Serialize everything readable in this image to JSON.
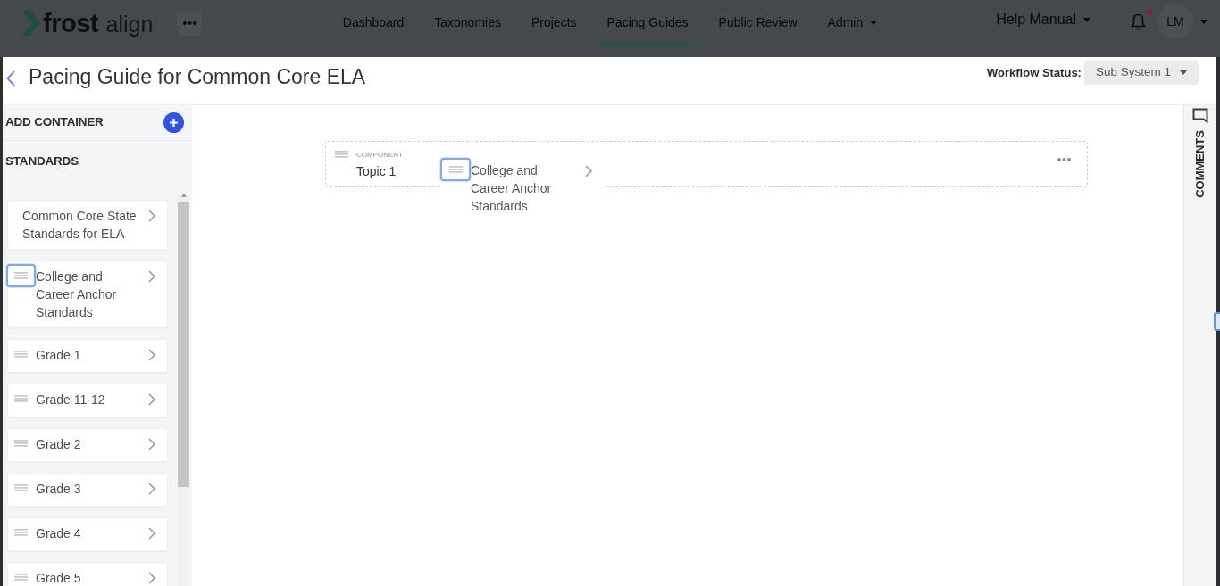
{
  "navbar": {
    "logo": {
      "brand": "frost",
      "product": "align"
    },
    "nav_items": [
      {
        "label": "Dashboard",
        "selected": false,
        "dropdown": false
      },
      {
        "label": "Taxonomies",
        "selected": false,
        "dropdown": false
      },
      {
        "label": "Projects",
        "selected": false,
        "dropdown": false
      },
      {
        "label": "Pacing Guides",
        "selected": true,
        "dropdown": false
      },
      {
        "label": "Public Review",
        "selected": false,
        "dropdown": false
      },
      {
        "label": "Admin",
        "selected": false,
        "dropdown": true
      }
    ],
    "help": {
      "label": "Help Manual",
      "dropdown": true
    },
    "notifications": {
      "unread": true
    },
    "user": {
      "initials": "LM"
    }
  },
  "header": {
    "title": "Pacing Guide for Common Core ELA",
    "workflow_label": "Workflow Status:",
    "workflow_value": "Sub System 1"
  },
  "sidebar": {
    "add_label": "ADD CONTAINER",
    "section_title": "STANDARDS",
    "items": [
      {
        "label": "Common Core State Standards for ELA",
        "handle": false,
        "dragging": false
      },
      {
        "label": "College and Career Anchor Standards",
        "handle": true,
        "dragging": true
      },
      {
        "label": "Grade 1",
        "handle": true,
        "dragging": false
      },
      {
        "label": "Grade 11-12",
        "handle": true,
        "dragging": false
      },
      {
        "label": "Grade 2",
        "handle": true,
        "dragging": false
      },
      {
        "label": "Grade 3",
        "handle": true,
        "dragging": false
      },
      {
        "label": "Grade 4",
        "handle": true,
        "dragging": false
      },
      {
        "label": "Grade 5",
        "handle": true,
        "dragging": false
      }
    ]
  },
  "canvas": {
    "components": [
      {
        "type_label": "COMPONENT",
        "title": "Topic 1"
      }
    ],
    "drag_preview": {
      "label": "College and Career Anchor Standards"
    }
  },
  "comments_panel": {
    "label": "COMMENTS"
  }
}
